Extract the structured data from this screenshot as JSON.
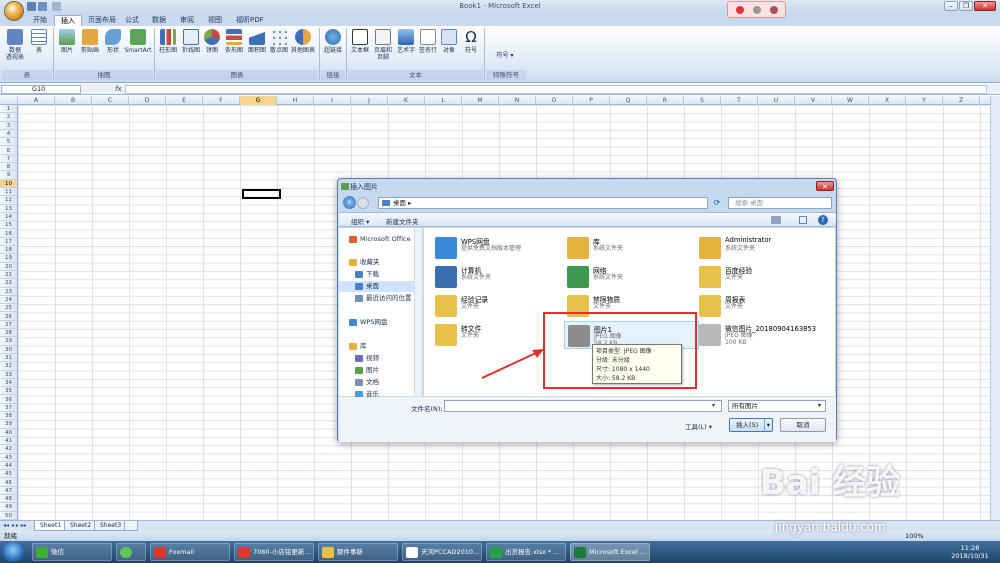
{
  "window": {
    "title": "Book1 - Microsoft Excel",
    "minimize": "–",
    "restore": "❐",
    "close": "✕"
  },
  "tabs": [
    "开始",
    "插入",
    "页面布局",
    "公式",
    "数据",
    "审阅",
    "视图",
    "福昕PDF"
  ],
  "ribbon": {
    "buttons": [
      "数据\n透视表",
      "表",
      "图片",
      "剪贴画",
      "形状",
      "SmartArt",
      "柱形图",
      "折线图",
      "饼图",
      "条形图",
      "面积图",
      "散点图",
      "其他图表",
      "超链接",
      "文本框",
      "页眉和\n页脚",
      "艺术字",
      "签名行",
      "对象",
      "符号",
      "符号"
    ],
    "groups": [
      "表",
      "插图",
      "图表",
      "链接",
      "文本",
      "特殊符号"
    ]
  },
  "formula": {
    "namebox": "G10",
    "fx": "fx"
  },
  "columns": [
    "A",
    "B",
    "C",
    "D",
    "E",
    "F",
    "G",
    "H",
    "I",
    "J",
    "K",
    "L",
    "M",
    "N",
    "O",
    "P",
    "Q",
    "R",
    "S",
    "T",
    "U",
    "V",
    "W",
    "X",
    "Y",
    "Z",
    "AA"
  ],
  "rows": [
    "1",
    "2",
    "3",
    "4",
    "5",
    "6",
    "7",
    "8",
    "9",
    "10",
    "11",
    "12",
    "13",
    "14",
    "15",
    "16",
    "17",
    "18",
    "19",
    "20",
    "21",
    "22",
    "23",
    "24",
    "25",
    "26",
    "27",
    "28",
    "29",
    "30",
    "31",
    "32",
    "33",
    "34",
    "35",
    "36",
    "37",
    "38",
    "39",
    "40",
    "41",
    "42",
    "43",
    "44",
    "45",
    "46",
    "47",
    "48",
    "49",
    "50"
  ],
  "sheets": [
    "Sheet1",
    "Sheet2",
    "Sheet3"
  ],
  "status": {
    "ready": "就绪",
    "zoom": "100%"
  },
  "dialog": {
    "title": "插入图片",
    "address": "桌面",
    "search_placeholder": "搜索 桌面",
    "toolbar": {
      "organize": "组织 ▾",
      "new_folder": "新建文件夹"
    },
    "nav": [
      {
        "label": "Microsoft Office",
        "indent": 0
      },
      {
        "label": "收藏夹",
        "indent": 0
      },
      {
        "label": "下载",
        "indent": 1
      },
      {
        "label": "桌面",
        "indent": 1,
        "selected": true
      },
      {
        "label": "最近访问的位置",
        "indent": 1
      },
      {
        "label": "WPS网盘",
        "indent": 0
      },
      {
        "label": "库",
        "indent": 0
      },
      {
        "label": "视频",
        "indent": 1
      },
      {
        "label": "图片",
        "indent": 1
      },
      {
        "label": "文档",
        "indent": 1
      },
      {
        "label": "音乐",
        "indent": 1
      }
    ],
    "items": [
      {
        "name": "WPS网盘",
        "sub": "提供免费文档版本管理"
      },
      {
        "name": "库",
        "sub": "系统文件夹"
      },
      {
        "name": "Administrator",
        "sub": "系统文件夹"
      },
      {
        "name": "计算机",
        "sub": "系统文件夹"
      },
      {
        "name": "网络",
        "sub": "系统文件夹"
      },
      {
        "name": "百度经验",
        "sub": "文件夹"
      },
      {
        "name": "经验记录",
        "sub": "文件夹"
      },
      {
        "name": "禁限物质",
        "sub": "文件夹"
      },
      {
        "name": "周报表",
        "sub": "文件夹"
      },
      {
        "name": "转文件",
        "sub": "文件夹"
      },
      {
        "name": "图片1",
        "sub": "JPEG 图像",
        "size": "58.2 KB"
      },
      {
        "name": "微信图片_20180904163853",
        "sub": "JPEG 图像",
        "size": "100 KB"
      }
    ],
    "tooltip": [
      "项目类型: JPEG 图像",
      "分级: 未分级",
      "尺寸: 1080 x 1440",
      "大小: 58.2 KB"
    ],
    "filename_label": "文件名(N):",
    "filter": "所有图片",
    "tools": "工具(L)  ▾",
    "insert": "插入(S)",
    "cancel": "取消"
  },
  "taskbar": {
    "items": [
      "微信",
      "",
      "Foxmail",
      "7080-小店铭更新...",
      "那件事新",
      "天河PCCAD2010...",
      "出货报告.xlsx * ...",
      "Microsoft Excel ..."
    ],
    "time": "11:28",
    "date": "2018/10/31"
  },
  "watermark": {
    "text": "Bai 经验",
    "url": "jingyan.baidu.com"
  }
}
